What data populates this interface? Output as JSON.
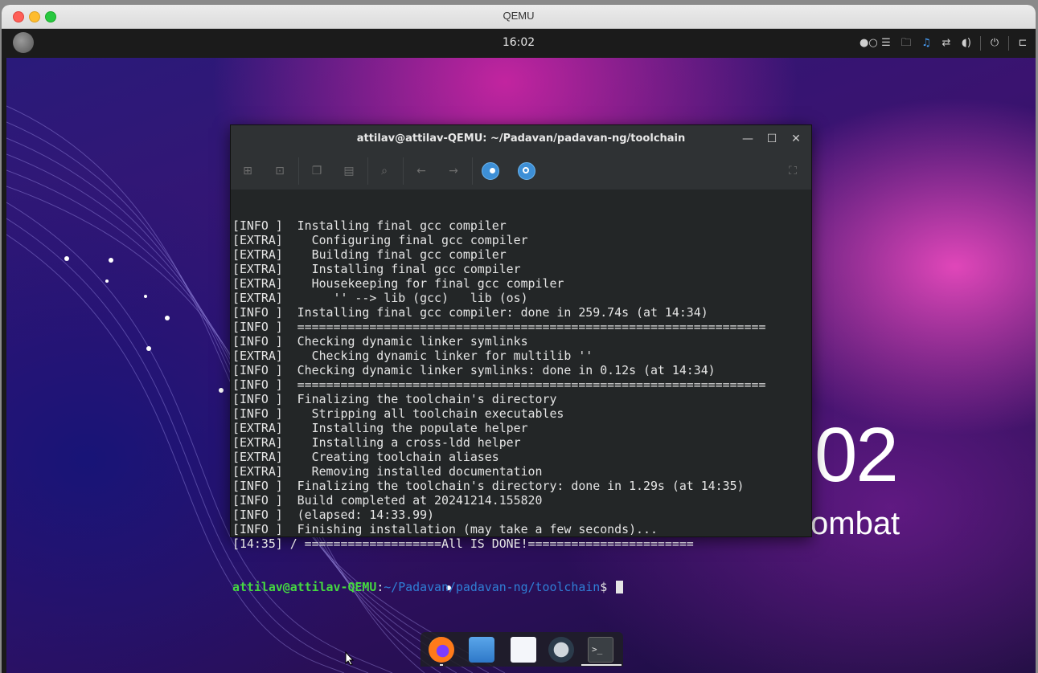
{
  "host": {
    "title": "QEMU"
  },
  "panel": {
    "clock": "16:02",
    "tray_icons": [
      "workspace-dots-icon",
      "menu-icon",
      "folder-icon",
      "bell-icon",
      "network-icon",
      "volume-icon",
      "power-icon",
      "sidebar-icon"
    ]
  },
  "desktop": {
    "clock_fragment": "02",
    "date_fragment": "ombat"
  },
  "terminal": {
    "title": "attilav@attilav-QEMU: ~/Padavan/padavan-ng/toolchain",
    "lines": [
      "[INFO ]  Installing final gcc compiler",
      "[EXTRA]    Configuring final gcc compiler",
      "[EXTRA]    Building final gcc compiler",
      "[EXTRA]    Installing final gcc compiler",
      "[EXTRA]    Housekeeping for final gcc compiler",
      "[EXTRA]       '' --> lib (gcc)   lib (os)",
      "[INFO ]  Installing final gcc compiler: done in 259.74s (at 14:34)",
      "[INFO ]  =================================================================",
      "[INFO ]  Checking dynamic linker symlinks",
      "[EXTRA]    Checking dynamic linker for multilib ''",
      "[INFO ]  Checking dynamic linker symlinks: done in 0.12s (at 14:34)",
      "[INFO ]  =================================================================",
      "[INFO ]  Finalizing the toolchain's directory",
      "[INFO ]    Stripping all toolchain executables",
      "[EXTRA]    Installing the populate helper",
      "[EXTRA]    Installing a cross-ldd helper",
      "[EXTRA]    Creating toolchain aliases",
      "[EXTRA]    Removing installed documentation",
      "[INFO ]  Finalizing the toolchain's directory: done in 1.29s (at 14:35)",
      "[INFO ]  Build completed at 20241214.155820",
      "[INFO ]  (elapsed: 14:33.99)",
      "[INFO ]  Finishing installation (may take a few seconds)...",
      "[14:35] / ===================All IS DONE!======================="
    ],
    "prompt": {
      "user_host": "attilav@attilav-QEMU",
      "colon": ":",
      "path": "~/Padavan/padavan-ng/toolchain",
      "symbol": "$ "
    },
    "colors": {
      "prompt_user": "#45d940",
      "prompt_path": "#2f7fd6"
    }
  },
  "dock": {
    "apps": [
      "firefox-icon",
      "files-icon",
      "text-editor-icon",
      "steam-icon",
      "terminal-icon"
    ],
    "terminal_glyph": ">_"
  }
}
